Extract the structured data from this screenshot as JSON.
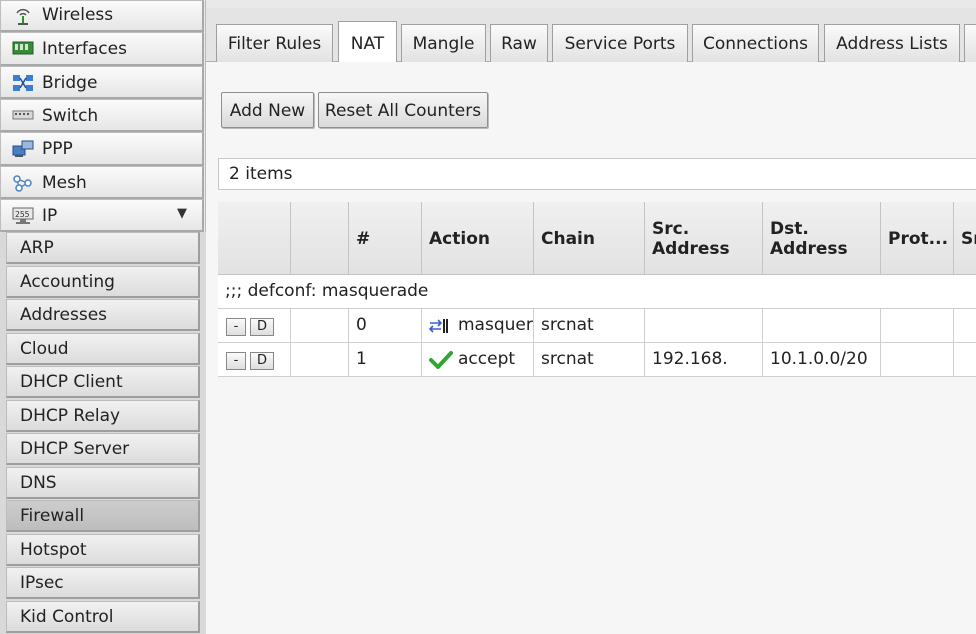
{
  "sidebar": {
    "items": [
      {
        "label": "Wireless",
        "icon": "wireless-icon"
      },
      {
        "label": "Interfaces",
        "icon": "interfaces-icon"
      },
      {
        "label": "Bridge",
        "icon": "bridge-icon"
      },
      {
        "label": "Switch",
        "icon": "switch-icon"
      },
      {
        "label": "PPP",
        "icon": "ppp-icon"
      },
      {
        "label": "Mesh",
        "icon": "mesh-icon"
      },
      {
        "label": "IP",
        "icon": "ip-icon",
        "expanded": true
      }
    ],
    "submenu": [
      {
        "label": "ARP"
      },
      {
        "label": "Accounting"
      },
      {
        "label": "Addresses"
      },
      {
        "label": "Cloud"
      },
      {
        "label": "DHCP Client"
      },
      {
        "label": "DHCP Relay"
      },
      {
        "label": "DHCP Server"
      },
      {
        "label": "DNS"
      },
      {
        "label": "Firewall",
        "active": true
      },
      {
        "label": "Hotspot"
      },
      {
        "label": "IPsec"
      },
      {
        "label": "Kid Control"
      }
    ],
    "expand_arrow": "▼"
  },
  "tabs": [
    {
      "label": "Filter Rules"
    },
    {
      "label": "NAT",
      "active": true
    },
    {
      "label": "Mangle"
    },
    {
      "label": "Raw"
    },
    {
      "label": "Service Ports"
    },
    {
      "label": "Connections"
    },
    {
      "label": "Address Lists"
    }
  ],
  "toolbar": {
    "add_new": "Add New",
    "reset_counters": "Reset All Counters"
  },
  "items_count": "2 items",
  "table": {
    "headers": [
      "",
      "",
      "#",
      "Action",
      "Chain",
      "Src.\nAddress",
      "Dst.\nAddress",
      "Prot...",
      "Sr"
    ],
    "comment": ";;; defconf: masquerade",
    "rows": [
      {
        "remove": "-",
        "disable": "D",
        "num": "0",
        "action": "masquerade",
        "action_icon": "masquerade-icon",
        "chain": "srcnat",
        "src": "",
        "dst": ""
      },
      {
        "remove": "-",
        "disable": "D",
        "num": "1",
        "action": "accept",
        "action_icon": "accept-checkmark-icon",
        "chain": "srcnat",
        "src": "192.168.",
        "dst": "10.1.0.0/20"
      }
    ]
  },
  "colors": {
    "accept_green": "#2fa82f",
    "masquerade_blue": "#3a5ed0"
  }
}
